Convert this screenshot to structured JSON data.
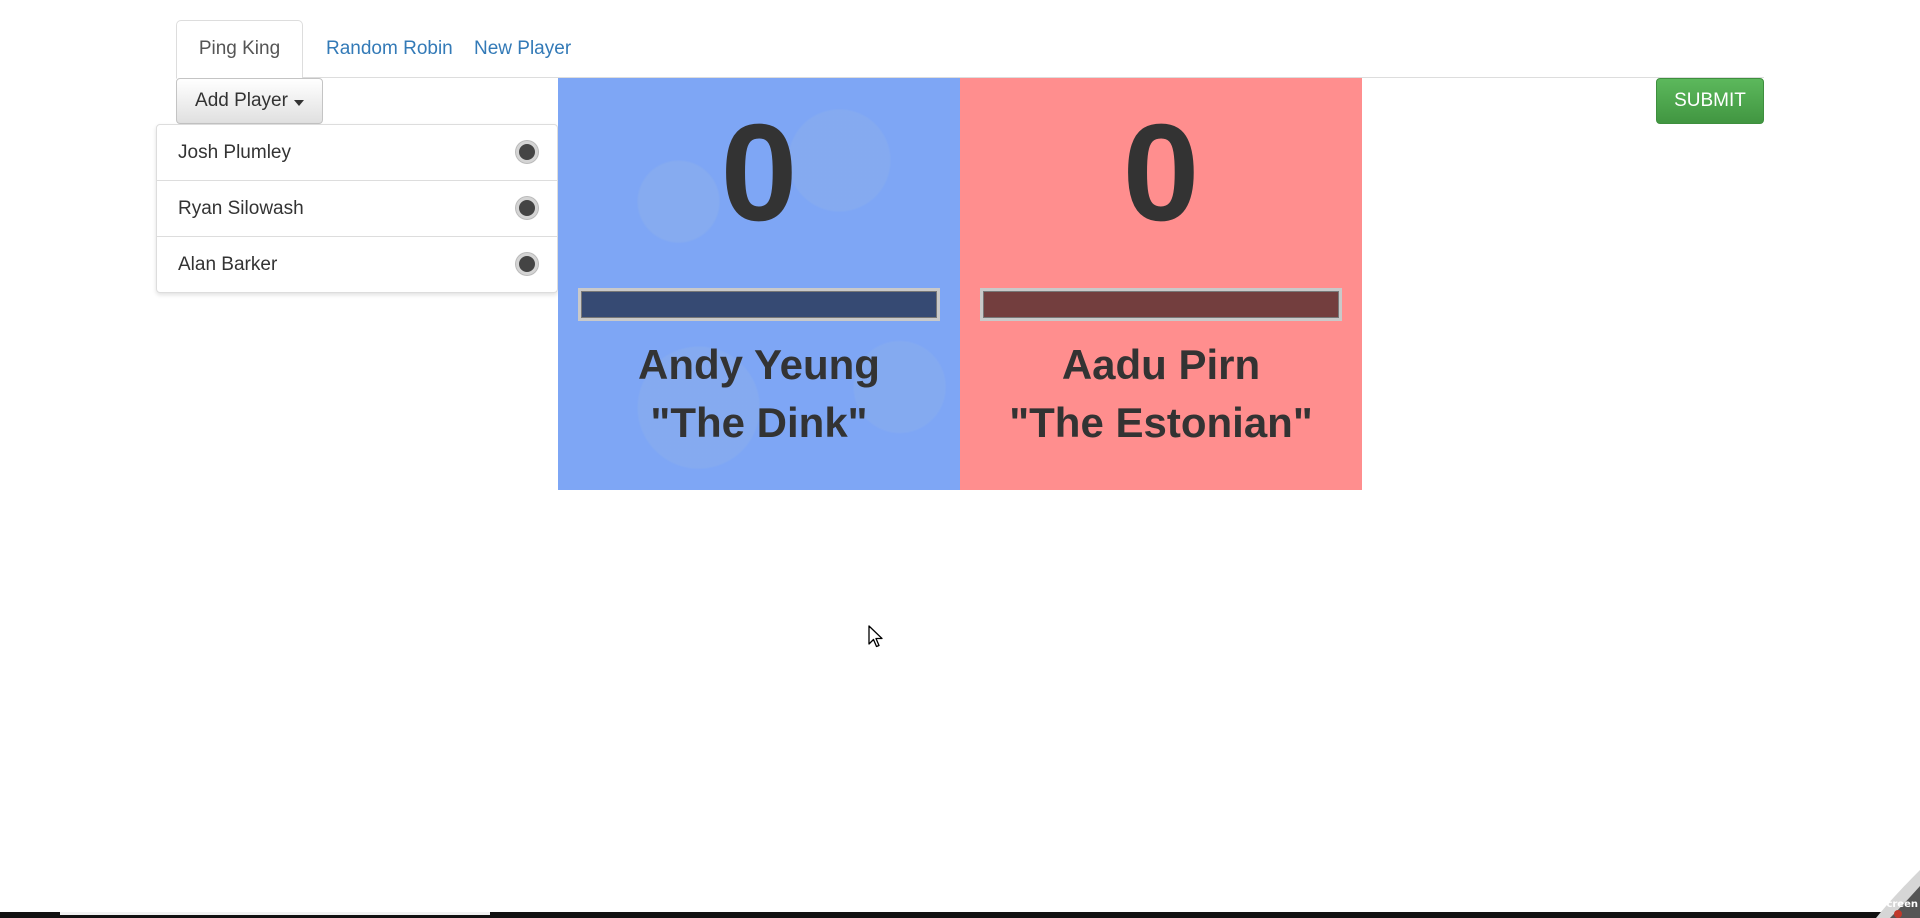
{
  "tabs": [
    {
      "label": "Ping King",
      "active": true
    },
    {
      "label": "Random Robin",
      "active": false
    },
    {
      "label": "New Player",
      "active": false
    }
  ],
  "add_player": {
    "label": "Add Player",
    "icon": "caret-down-icon"
  },
  "players": [
    {
      "name": "Josh Plumley"
    },
    {
      "name": "Ryan Silowash"
    },
    {
      "name": "Alan Barker"
    }
  ],
  "submit": {
    "label": "SUBMIT",
    "color": "#5cb85c"
  },
  "player1": {
    "score": "0",
    "name": "Andy Yeung",
    "nickname": "\"The Dink\"",
    "panel_color": "#7ea6f5",
    "bar_color": "#364a73"
  },
  "player2": {
    "score": "0",
    "name": "Aadu Pirn",
    "nickname": "\"The Estonian\"",
    "panel_color": "#ff8e8e",
    "bar_color": "#733e3e"
  },
  "taskbar": {
    "corner_label": "Screen"
  }
}
